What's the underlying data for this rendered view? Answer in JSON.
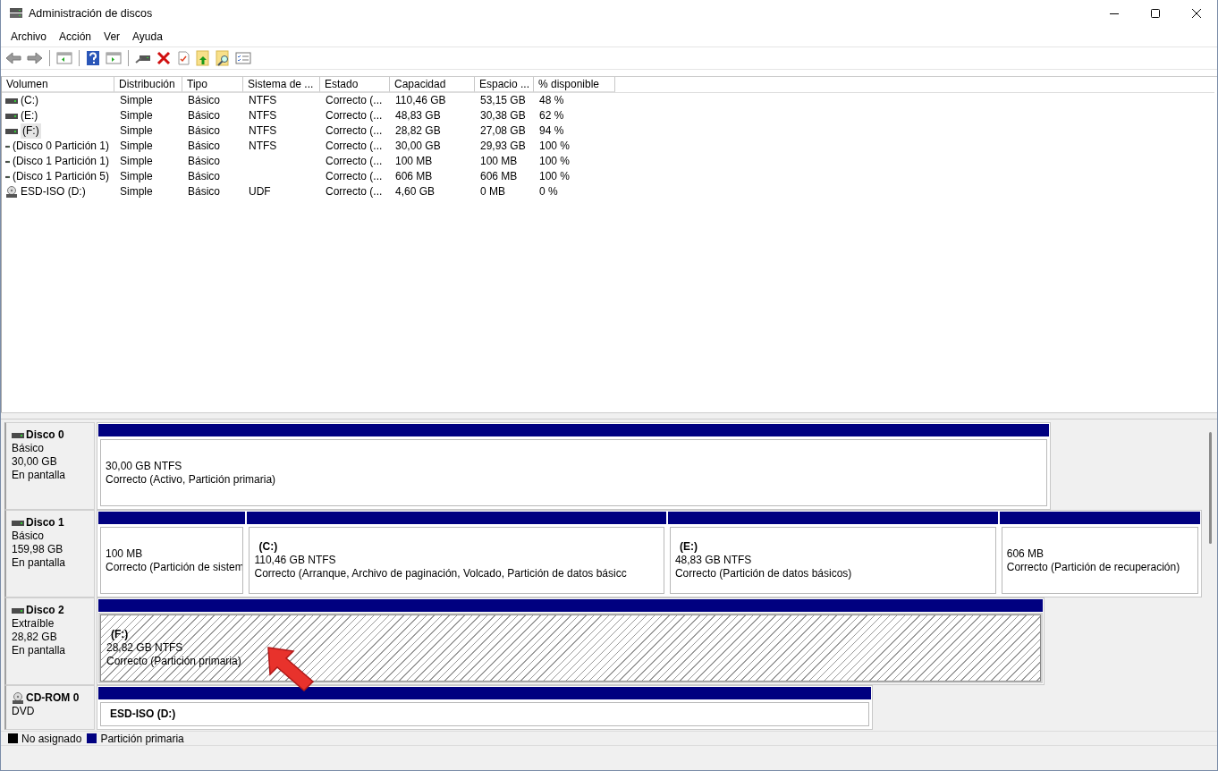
{
  "window": {
    "title": "Administración de discos"
  },
  "menu": [
    "Archivo",
    "Acción",
    "Ver",
    "Ayuda"
  ],
  "table": {
    "columns": [
      "Volumen",
      "Distribución",
      "Tipo",
      "Sistema de ...",
      "Estado",
      "Capacidad",
      "Espacio ...",
      "% disponible"
    ],
    "rows": [
      {
        "kind": "disk",
        "selected": false,
        "cells": [
          "(C:)",
          "Simple",
          "Básico",
          "NTFS",
          "Correcto (...",
          "110,46 GB",
          "53,15 GB",
          "48 %"
        ]
      },
      {
        "kind": "disk",
        "selected": false,
        "cells": [
          "(E:)",
          "Simple",
          "Básico",
          "NTFS",
          "Correcto (...",
          "48,83 GB",
          "30,38 GB",
          "62 %"
        ]
      },
      {
        "kind": "disk",
        "selected": true,
        "cells": [
          "(F:)",
          "Simple",
          "Básico",
          "NTFS",
          "Correcto (...",
          "28,82 GB",
          "27,08 GB",
          "94 %"
        ]
      },
      {
        "kind": "disk",
        "selected": false,
        "cells": [
          "(Disco 0 Partición 1)",
          "Simple",
          "Básico",
          "NTFS",
          "Correcto (...",
          "30,00 GB",
          "29,93 GB",
          "100 %"
        ]
      },
      {
        "kind": "disk",
        "selected": false,
        "cells": [
          "(Disco 1 Partición 1)",
          "Simple",
          "Básico",
          "",
          "Correcto (...",
          "100 MB",
          "100 MB",
          "100 %"
        ]
      },
      {
        "kind": "disk",
        "selected": false,
        "cells": [
          "(Disco 1 Partición 5)",
          "Simple",
          "Básico",
          "",
          "Correcto (...",
          "606 MB",
          "606 MB",
          "100 %"
        ]
      },
      {
        "kind": "cdrom",
        "selected": false,
        "cells": [
          "ESD-ISO (D:)",
          "Simple",
          "Básico",
          "UDF",
          "Correcto (...",
          "4,60 GB",
          "0 MB",
          "0 %"
        ]
      }
    ]
  },
  "disks": [
    {
      "kind": "disk",
      "name": "Disco 0",
      "lines": [
        "Básico",
        "30,00 GB",
        "En pantalla"
      ],
      "partitions": [
        {
          "selected": false,
          "size": "30,00 GB NTFS",
          "status": "Correcto (Activo, Partición primaria)"
        }
      ]
    },
    {
      "kind": "disk",
      "name": "Disco 1",
      "lines": [
        "Básico",
        "159,98 GB",
        "En pantalla"
      ],
      "partitions": [
        {
          "selected": false,
          "size": "100 MB",
          "status": "Correcto (Partición de sistem"
        },
        {
          "selected": false,
          "name": "(C:)",
          "size": "110,46 GB NTFS",
          "status": "Correcto (Arranque, Archivo de paginación, Volcado, Partición de datos básicc"
        },
        {
          "selected": false,
          "name": "(E:)",
          "size": "48,83 GB NTFS",
          "status": "Correcto (Partición de datos básicos)"
        },
        {
          "selected": false,
          "size": "606 MB",
          "status": "Correcto (Partición de recuperación)"
        }
      ]
    },
    {
      "kind": "disk",
      "name": "Disco 2",
      "lines": [
        "Extraíble",
        "28,82 GB",
        "En pantalla"
      ],
      "partitions": [
        {
          "selected": true,
          "name": "(F:)",
          "size": "28,82 GB NTFS",
          "status": "Correcto (Partición primaria)"
        }
      ]
    },
    {
      "kind": "cdrom",
      "name": "CD-ROM 0",
      "lines": [
        "DVD"
      ],
      "partitions": [
        {
          "selected": false,
          "name": "ESD-ISO  (D:)"
        }
      ]
    }
  ],
  "legend": [
    {
      "label": "No asignado",
      "color": "#000000"
    },
    {
      "label": "Partición primaria",
      "color": "#000080"
    }
  ]
}
